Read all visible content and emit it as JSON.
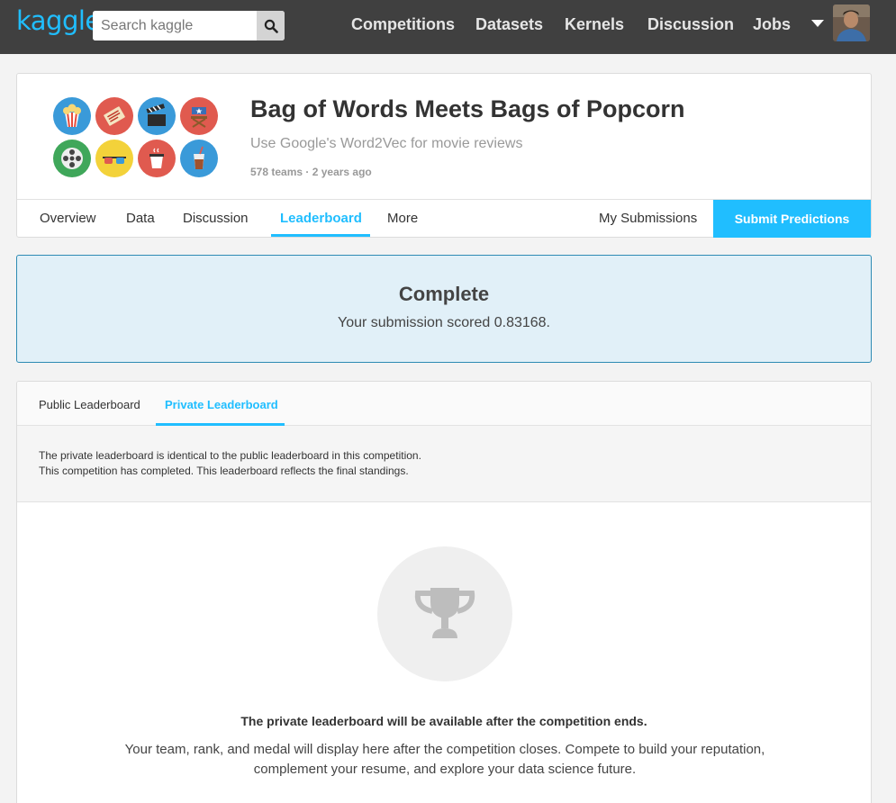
{
  "navbar": {
    "logo": "kaggle",
    "search_placeholder": "Search kaggle",
    "links": [
      "Competitions",
      "Datasets",
      "Kernels",
      "Discussion",
      "Jobs"
    ]
  },
  "competition": {
    "title": "Bag of Words Meets Bags of Popcorn",
    "subtitle": "Use Google's Word2Vec for movie reviews",
    "meta": "578 teams · 2 years ago",
    "tabs": [
      "Overview",
      "Data",
      "Discussion",
      "Leaderboard",
      "More"
    ],
    "active_tab": "Leaderboard",
    "my_submissions": "My Submissions",
    "submit_label": "Submit Predictions"
  },
  "alert": {
    "title": "Complete",
    "message": "Your submission scored 0.83168."
  },
  "leaderboard": {
    "tabs": [
      "Public Leaderboard",
      "Private Leaderboard"
    ],
    "active_tab": "Private Leaderboard",
    "note_line1": "The private leaderboard is identical to the public leaderboard in this competition.",
    "note_line2": "This competition has completed. This leaderboard reflects the final standings.",
    "heading": "The private leaderboard will be available after the competition ends.",
    "description": "Your team, rank, and medal will display here after the competition closes. Compete to build your reputation, complement your resume, and explore your data science future."
  },
  "colors": {
    "accent": "#20beff",
    "navbar_bg": "#404040",
    "alert_bg": "#e1f0f8",
    "alert_border": "#2e8bb4"
  },
  "icons": [
    "search-icon",
    "caret-down-icon",
    "popcorn-icon",
    "ticket-icon",
    "clapperboard-icon",
    "directors-chair-icon",
    "film-reel-icon",
    "3d-glasses-icon",
    "coffee-icon",
    "soda-cup-icon",
    "trophy-icon"
  ]
}
